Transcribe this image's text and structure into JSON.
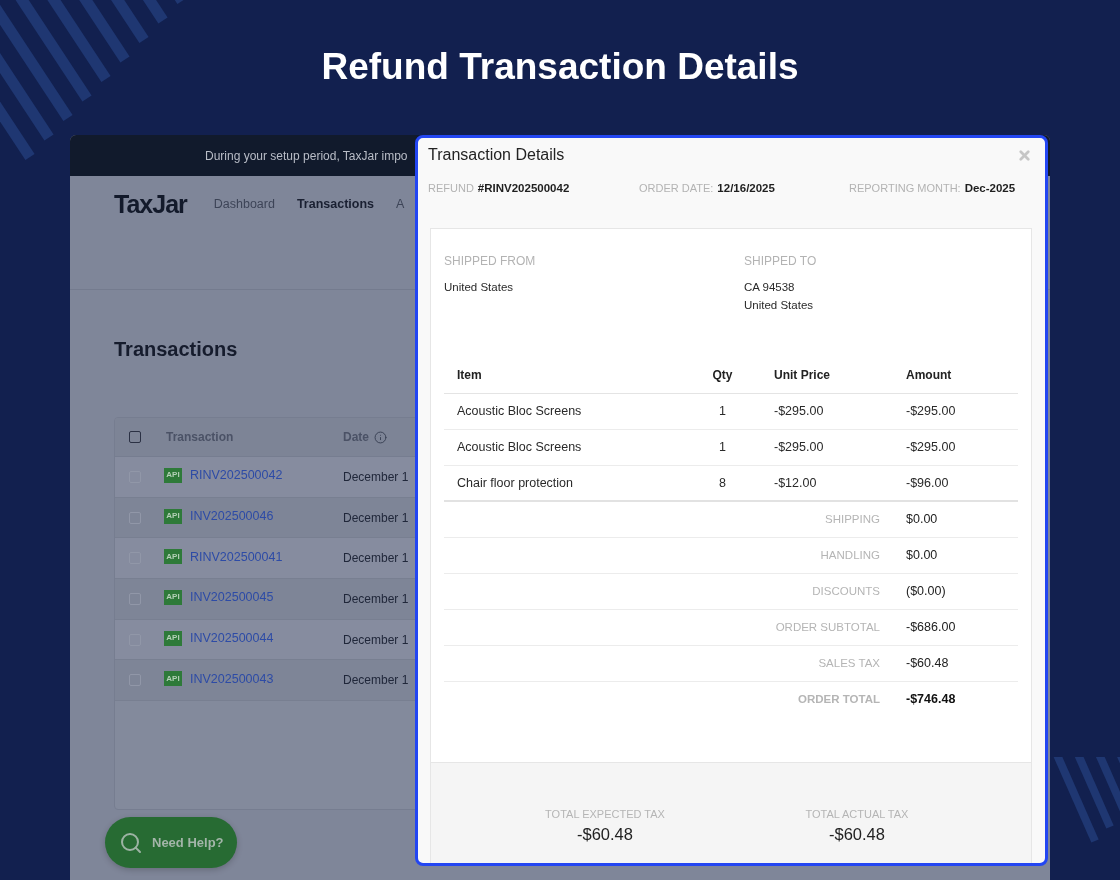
{
  "page_title": "Refund Transaction Details",
  "app": {
    "banner": "During your setup period, TaxJar impo",
    "logo": "TaxJar",
    "nav": [
      {
        "label": "Dashboard",
        "selected": false
      },
      {
        "label": "Transactions",
        "selected": true
      },
      {
        "label": "A",
        "selected": false
      }
    ],
    "heading": "Transactions",
    "table": {
      "columns": [
        "Transaction",
        "Date"
      ],
      "select_all_checked": false,
      "rows": [
        {
          "checked": false,
          "source": "API",
          "id": "RINV202500042",
          "date": "December 1"
        },
        {
          "checked": false,
          "source": "API",
          "id": "INV202500046",
          "date": "December 1"
        },
        {
          "checked": false,
          "source": "API",
          "id": "RINV202500041",
          "date": "December 1"
        },
        {
          "checked": false,
          "source": "API",
          "id": "INV202500045",
          "date": "December 1"
        },
        {
          "checked": false,
          "source": "API",
          "id": "INV202500044",
          "date": "December 1"
        },
        {
          "checked": false,
          "source": "API",
          "id": "INV202500043",
          "date": "December 1"
        }
      ]
    },
    "help_button": "Need Help?"
  },
  "modal": {
    "title": "Transaction Details",
    "meta": [
      {
        "label": "REFUND",
        "value": "#RINV202500042"
      },
      {
        "label": "ORDER DATE:",
        "value": "12/16/2025"
      },
      {
        "label": "REPORTING MONTH:",
        "value": "Dec-2025"
      }
    ],
    "shipped_from": {
      "label": "SHIPPED FROM",
      "lines": [
        "United States"
      ]
    },
    "shipped_to": {
      "label": "SHIPPED TO",
      "lines": [
        "CA 94538",
        "United States"
      ]
    },
    "items": {
      "columns": [
        "Item",
        "Qty",
        "Unit Price",
        "Amount"
      ],
      "rows": [
        {
          "item": "Acoustic Bloc Screens",
          "qty": "1",
          "unit_price": "-$295.00",
          "amount": "-$295.00"
        },
        {
          "item": "Acoustic Bloc Screens",
          "qty": "1",
          "unit_price": "-$295.00",
          "amount": "-$295.00"
        },
        {
          "item": "Chair floor protection",
          "qty": "8",
          "unit_price": "-$12.00",
          "amount": "-$96.00"
        }
      ]
    },
    "summary": [
      {
        "kind": "line",
        "label": "SHIPPING",
        "value": "$0.00"
      },
      {
        "kind": "line",
        "label": "HANDLING",
        "value": "$0.00"
      },
      {
        "kind": "line",
        "label": "DISCOUNTS",
        "value": "($0.00)"
      },
      {
        "kind": "line",
        "label": "ORDER SUBTOTAL",
        "value": "-$686.00"
      },
      {
        "kind": "line",
        "label": "SALES TAX",
        "value": "-$60.48"
      },
      {
        "kind": "total",
        "label": "ORDER TOTAL",
        "value": "-$746.48"
      }
    ],
    "totals": [
      {
        "label": "TOTAL EXPECTED TAX",
        "value": "-$60.48"
      },
      {
        "label": "TOTAL ACTUAL TAX",
        "value": "-$60.48"
      }
    ]
  }
}
